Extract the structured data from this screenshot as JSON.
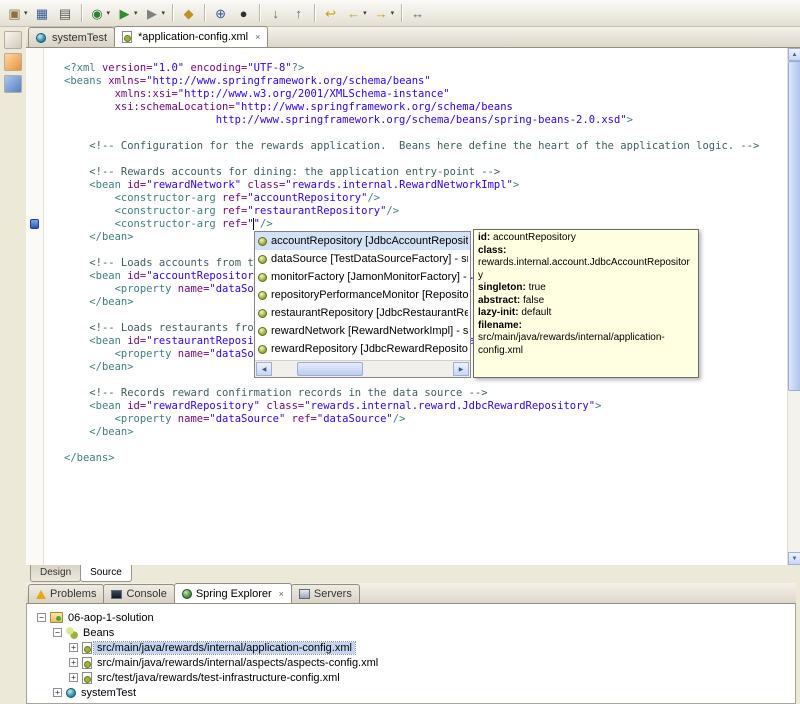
{
  "ui": {
    "close_glyph": "×",
    "dropdown_glyph": "▾",
    "expander_plus": "+",
    "expander_minus": "−",
    "scroll_up": "▲",
    "scroll_down": "▼",
    "scroll_left": "◀",
    "scroll_right": "▶"
  },
  "toolbar": {
    "items": [
      {
        "name": "new-wizard-button",
        "glyph": "▣",
        "color": "#8a6f3f",
        "dropdown": true
      },
      {
        "name": "save-button",
        "glyph": "▦",
        "color": "#35589a"
      },
      {
        "name": "print-button",
        "glyph": "▤",
        "color": "#555555"
      },
      {
        "sep": true
      },
      {
        "name": "debug-button",
        "glyph": "◉",
        "color": "#2f7f2f",
        "dropdown": true
      },
      {
        "name": "run-button",
        "glyph": "▶",
        "color": "#2f8f2f",
        "dropdown": true
      },
      {
        "name": "external-tools-button",
        "glyph": "▶",
        "color": "#808080",
        "dropdown": true
      },
      {
        "sep": true
      },
      {
        "name": "open-type-button",
        "glyph": "◆",
        "color": "#c09020"
      },
      {
        "sep": true
      },
      {
        "name": "search-button",
        "glyph": "⊕",
        "color": "#35589a"
      },
      {
        "name": "record-button",
        "glyph": "●",
        "color": "#303030"
      },
      {
        "sep": true
      },
      {
        "name": "next-annotation-button",
        "glyph": "↓",
        "color": "#606880"
      },
      {
        "name": "previous-annotation-button",
        "glyph": "↑",
        "color": "#606880"
      },
      {
        "sep": true
      },
      {
        "name": "last-edit-location-button",
        "glyph": "↩",
        "color": "#c8a000"
      },
      {
        "name": "back-button",
        "glyph": "←",
        "color": "#c8a000",
        "dropdown": true
      },
      {
        "name": "forward-button",
        "glyph": "→",
        "color": "#c8a000",
        "dropdown": true
      },
      {
        "sep": true
      },
      {
        "name": "link-with-editor-button",
        "glyph": "↔",
        "color": "#567090"
      }
    ]
  },
  "editor_tabs": [
    {
      "label": "systemTest",
      "icon": "systemtest",
      "active": false,
      "closable": false
    },
    {
      "label": "*application-config.xml",
      "icon": "beans-config",
      "active": true,
      "closable": true
    }
  ],
  "code": {
    "lines": [
      [
        [
          "pi",
          "<?xml "
        ],
        [
          "attr",
          "version="
        ],
        [
          "val",
          "\"1.0\""
        ],
        [
          "plain",
          " "
        ],
        [
          "attr",
          "encoding="
        ],
        [
          "val",
          "\"UTF-8\""
        ],
        [
          "pi",
          "?>"
        ]
      ],
      [
        [
          "tag",
          "<beans "
        ],
        [
          "attr",
          "xmlns="
        ],
        [
          "val",
          "\"http://www.springframework.org/schema/beans\""
        ]
      ],
      [
        [
          "plain",
          "        "
        ],
        [
          "attr",
          "xmlns:xsi="
        ],
        [
          "val",
          "\"http://www.w3.org/2001/XMLSchema-instance\""
        ]
      ],
      [
        [
          "plain",
          "        "
        ],
        [
          "attr",
          "xsi:schemaLocation="
        ],
        [
          "val",
          "\"http://www.springframework.org/schema/beans"
        ]
      ],
      [
        [
          "plain",
          "                        "
        ],
        [
          "val",
          "http://www.springframework.org/schema/beans/spring-beans-2.0.xsd\""
        ],
        [
          "tag",
          ">"
        ]
      ],
      [],
      [
        [
          "plain",
          "    "
        ],
        [
          "comment",
          "<!-- Configuration for the rewards application.  Beans here define the heart of the application logic. -->"
        ]
      ],
      [],
      [
        [
          "plain",
          "    "
        ],
        [
          "comment",
          "<!-- Rewards accounts for dining: the application entry-point -->"
        ]
      ],
      [
        [
          "plain",
          "    "
        ],
        [
          "tag",
          "<bean "
        ],
        [
          "attr",
          "id="
        ],
        [
          "val",
          "\"rewardNetwork\""
        ],
        [
          "plain",
          " "
        ],
        [
          "attr",
          "class="
        ],
        [
          "val",
          "\"rewards.internal.RewardNetworkImpl\""
        ],
        [
          "tag",
          ">"
        ]
      ],
      [
        [
          "plain",
          "        "
        ],
        [
          "tag",
          "<constructor-arg "
        ],
        [
          "attr",
          "ref="
        ],
        [
          "val",
          "\"accountRepository\""
        ],
        [
          "tag",
          "/>"
        ]
      ],
      [
        [
          "plain",
          "        "
        ],
        [
          "tag",
          "<constructor-arg "
        ],
        [
          "attr",
          "ref="
        ],
        [
          "val",
          "\"restaurantRepository\""
        ],
        [
          "tag",
          "/>"
        ]
      ],
      [
        [
          "plain",
          "        "
        ],
        [
          "tag",
          "<constructor-arg "
        ],
        [
          "attr",
          "ref="
        ],
        [
          "val",
          "\"\""
        ],
        [
          "tag",
          "/>"
        ]
      ],
      [
        [
          "plain",
          "    "
        ],
        [
          "tag",
          "</bean>"
        ]
      ],
      [],
      [
        [
          "plain",
          "    "
        ],
        [
          "comment",
          "<!-- Loads accounts from the data source -->"
        ]
      ],
      [
        [
          "plain",
          "    "
        ],
        [
          "tag",
          "<bean "
        ],
        [
          "attr",
          "id="
        ],
        [
          "val",
          "\"accountRepository\""
        ],
        [
          "plain",
          " "
        ],
        [
          "attr",
          "class="
        ],
        [
          "val",
          "\"rewards.internal.account.JdbcAccountRepository\""
        ],
        [
          "tag",
          ">"
        ]
      ],
      [
        [
          "plain",
          "        "
        ],
        [
          "tag",
          "<property "
        ],
        [
          "attr",
          "name="
        ],
        [
          "val",
          "\"dataSource\""
        ],
        [
          "plain",
          " "
        ],
        [
          "attr",
          "ref="
        ],
        [
          "val",
          "\"dataSource\""
        ],
        [
          "tag",
          "/>"
        ]
      ],
      [
        [
          "plain",
          "    "
        ],
        [
          "tag",
          "</bean>"
        ]
      ],
      [],
      [
        [
          "plain",
          "    "
        ],
        [
          "comment",
          "<!-- Loads restaurants from the data source -->"
        ]
      ],
      [
        [
          "plain",
          "    "
        ],
        [
          "tag",
          "<bean "
        ],
        [
          "attr",
          "id="
        ],
        [
          "val",
          "\"restaurantRepository\""
        ],
        [
          "plain",
          " "
        ],
        [
          "attr",
          "class="
        ],
        [
          "val",
          "\"rewards.internal.restaurant.JdbcRestaurantRepository\""
        ],
        [
          "tag",
          ">"
        ]
      ],
      [
        [
          "plain",
          "        "
        ],
        [
          "tag",
          "<property "
        ],
        [
          "attr",
          "name="
        ],
        [
          "val",
          "\"dataSource\""
        ],
        [
          "plain",
          " "
        ],
        [
          "attr",
          "ref="
        ],
        [
          "val",
          "\"dataSource\""
        ],
        [
          "tag",
          "/>"
        ]
      ],
      [
        [
          "plain",
          "    "
        ],
        [
          "tag",
          "</bean>"
        ]
      ],
      [],
      [
        [
          "plain",
          "    "
        ],
        [
          "comment",
          "<!-- Records reward confirmation records in the data source -->"
        ]
      ],
      [
        [
          "plain",
          "    "
        ],
        [
          "tag",
          "<bean "
        ],
        [
          "attr",
          "id="
        ],
        [
          "val",
          "\"rewardRepository\""
        ],
        [
          "plain",
          " "
        ],
        [
          "attr",
          "class="
        ],
        [
          "val",
          "\"rewards.internal.reward.JdbcRewardRepository\""
        ],
        [
          "tag",
          ">"
        ]
      ],
      [
        [
          "plain",
          "        "
        ],
        [
          "tag",
          "<property "
        ],
        [
          "attr",
          "name="
        ],
        [
          "val",
          "\"dataSource\""
        ],
        [
          "plain",
          " "
        ],
        [
          "attr",
          "ref="
        ],
        [
          "val",
          "\"dataSource\""
        ],
        [
          "tag",
          "/>"
        ]
      ],
      [
        [
          "plain",
          "    "
        ],
        [
          "tag",
          "</bean>"
        ]
      ],
      [],
      [
        [
          "tag",
          "</beans>"
        ]
      ]
    ]
  },
  "content_assist": {
    "selected_index": 0,
    "items": [
      {
        "label": "accountRepository [JdbcAccountRepository] - src/main/java"
      },
      {
        "label": "dataSource [TestDataSourceFactory] - src/test/java"
      },
      {
        "label": "monitorFactory [JamonMonitorFactory] - src/main/java"
      },
      {
        "label": "repositoryPerformanceMonitor [RepositoryPerformanceMonitor]"
      },
      {
        "label": "restaurantRepository [JdbcRestaurantRepository] - src"
      },
      {
        "label": "rewardNetwork [RewardNetworkImpl] - src/main/java"
      },
      {
        "label": "rewardRepository [JdbcRewardRepository] - src/main"
      }
    ]
  },
  "tooltip": {
    "rows": [
      {
        "label": "id:",
        "value": "accountRepository",
        "block": false
      },
      {
        "label": "class:",
        "value": "rewards.internal.account.JdbcAccountRepository",
        "block": true
      },
      {
        "label": "singleton:",
        "value": "true",
        "block": false
      },
      {
        "label": "abstract:",
        "value": "false",
        "block": false
      },
      {
        "label": "lazy-init:",
        "value": "default",
        "block": false
      },
      {
        "label": "filename:",
        "value": "src/main/java/rewards/internal/application-config.xml",
        "block": false
      }
    ]
  },
  "editor_mode_tabs": [
    {
      "label": "Design",
      "active": false
    },
    {
      "label": "Source",
      "active": true
    }
  ],
  "bottom_tabs": [
    {
      "label": "Problems",
      "icon": "problems",
      "active": false
    },
    {
      "label": "Console",
      "icon": "console",
      "active": false
    },
    {
      "label": "Spring Explorer",
      "icon": "spring",
      "active": true,
      "closable": true
    },
    {
      "label": "Servers",
      "icon": "servers",
      "active": false
    }
  ],
  "tree": {
    "items": [
      {
        "label": "06-aop-1-solution",
        "level": 0,
        "expander": "minus",
        "icon": "spring-project",
        "selected": false
      },
      {
        "label": "Beans",
        "level": 1,
        "expander": "minus",
        "icon": "beans",
        "selected": false
      },
      {
        "label": "src/main/java/rewards/internal/application-config.xml",
        "level": 2,
        "expander": "plus",
        "icon": "beans-config",
        "selected": true
      },
      {
        "label": "src/main/java/rewards/internal/aspects/aspects-config.xml",
        "level": 2,
        "expander": "plus",
        "icon": "beans-config",
        "selected": false
      },
      {
        "label": "src/test/java/rewards/test-infrastructure-config.xml",
        "level": 2,
        "expander": "plus",
        "icon": "beans-config",
        "selected": false
      },
      {
        "label": "systemTest",
        "level": 1,
        "expander": "plus",
        "icon": "systemtest",
        "selected": false
      }
    ]
  }
}
